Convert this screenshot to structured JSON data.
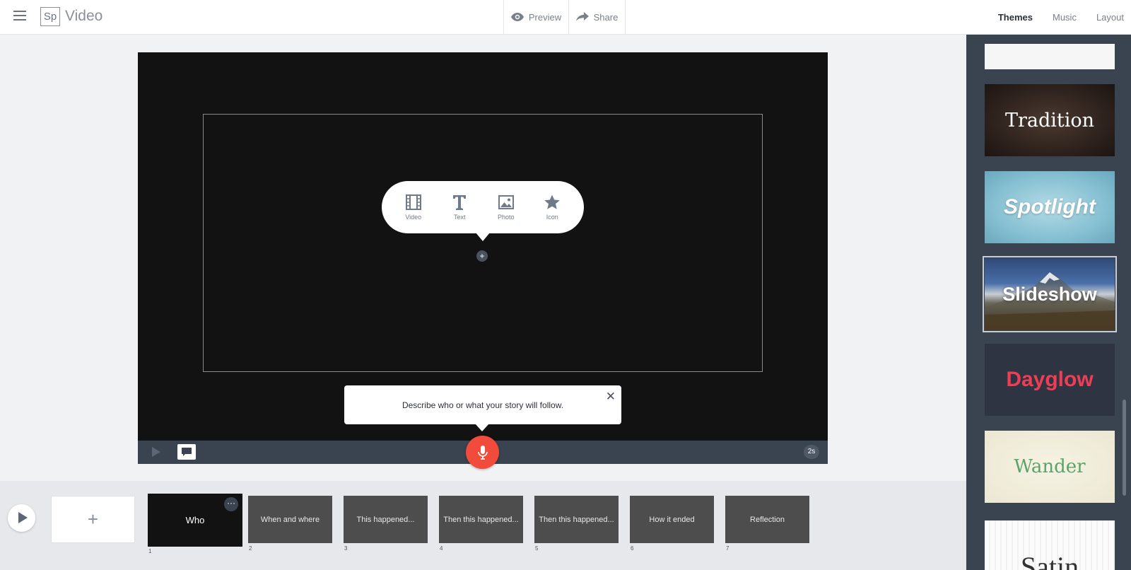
{
  "header": {
    "logo": "Sp",
    "app_title": "Video",
    "preview_label": "Preview",
    "share_label": "Share",
    "tabs": [
      {
        "label": "Themes",
        "active": true
      },
      {
        "label": "Music",
        "active": false
      },
      {
        "label": "Layout",
        "active": false
      }
    ]
  },
  "stage": {
    "insert_options": [
      {
        "label": "Video",
        "icon": "film-icon"
      },
      {
        "label": "Text",
        "icon": "text-icon"
      },
      {
        "label": "Photo",
        "icon": "photo-icon"
      },
      {
        "label": "Icon",
        "icon": "star-icon"
      }
    ],
    "duration_badge": "2s"
  },
  "prompt": {
    "text": "Describe who or what your story will follow."
  },
  "timeline": {
    "add_label": "+",
    "slides": [
      {
        "label": "Who",
        "number": "1",
        "active": true
      },
      {
        "label": "When and where",
        "number": "2",
        "active": false
      },
      {
        "label": "This happened...",
        "number": "3",
        "active": false
      },
      {
        "label": "Then this happened...",
        "number": "4",
        "active": false
      },
      {
        "label": "Then this happened...",
        "number": "5",
        "active": false
      },
      {
        "label": "How it ended",
        "number": "6",
        "active": false
      },
      {
        "label": "Reflection",
        "number": "7",
        "active": false
      }
    ]
  },
  "themes": [
    {
      "name": "",
      "selected": false
    },
    {
      "name": "Tradition",
      "selected": false
    },
    {
      "name": "Spotlight",
      "selected": false
    },
    {
      "name": "Slideshow",
      "selected": true
    },
    {
      "name": "Dayglow",
      "selected": false
    },
    {
      "name": "Wander",
      "selected": false
    },
    {
      "name": "Satin",
      "selected": false
    }
  ],
  "colors": {
    "accent_red": "#f04b3b",
    "panel_dark": "#3a4350",
    "dayglow_pink": "#ee3e55",
    "wander_green": "#5aa36a"
  }
}
